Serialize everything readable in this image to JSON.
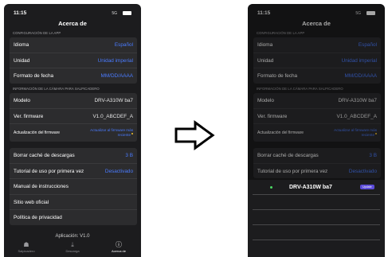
{
  "status": {
    "time": "11:15",
    "signal": "5G"
  },
  "header": {
    "title": "Acerca de"
  },
  "app_config": {
    "section_title": "CONFIGURACIÓN DE LA APP",
    "rows": [
      {
        "label": "Idioma",
        "value": "Español"
      },
      {
        "label": "Unidad",
        "value": "Unidad imperial"
      },
      {
        "label": "Formato de fecha",
        "value": "MM/DD/AAAA"
      }
    ]
  },
  "camera_info": {
    "section_title": "INFORMACIÓN DE LA CÁMARA PARA SALPICADERO",
    "rows": [
      {
        "label": "Modelo",
        "value": "DRV-A310W ba7"
      },
      {
        "label": "Ver. firmware",
        "value": "V1.0_ABCDEF_A"
      },
      {
        "label": "Actualización del firmware",
        "value": "Actualizar al firmware más reciente"
      }
    ]
  },
  "misc": {
    "rows": [
      {
        "label": "Borrar caché de descargas",
        "value": "3 B"
      },
      {
        "label": "Tutorial de uso por primera vez",
        "value": "Desactivado"
      },
      {
        "label": "Manual de instrucciones"
      },
      {
        "label": "Sitio web oficial"
      },
      {
        "label": "Política de privacidad"
      }
    ]
  },
  "version": "Aplicación: V1.0",
  "tabs": [
    {
      "label": "Salpicadero",
      "icon": "home-icon"
    },
    {
      "label": "Descarga",
      "icon": "download-icon"
    },
    {
      "label": "Acerca de",
      "icon": "info-icon"
    }
  ],
  "sheet": {
    "device": "DRV-A310W ba7",
    "badge": "Update"
  },
  "colors": {
    "accent": "#4a7bff",
    "background": "#1c1c1e",
    "badge": "#5b4bd8",
    "connected": "#4cd964"
  }
}
